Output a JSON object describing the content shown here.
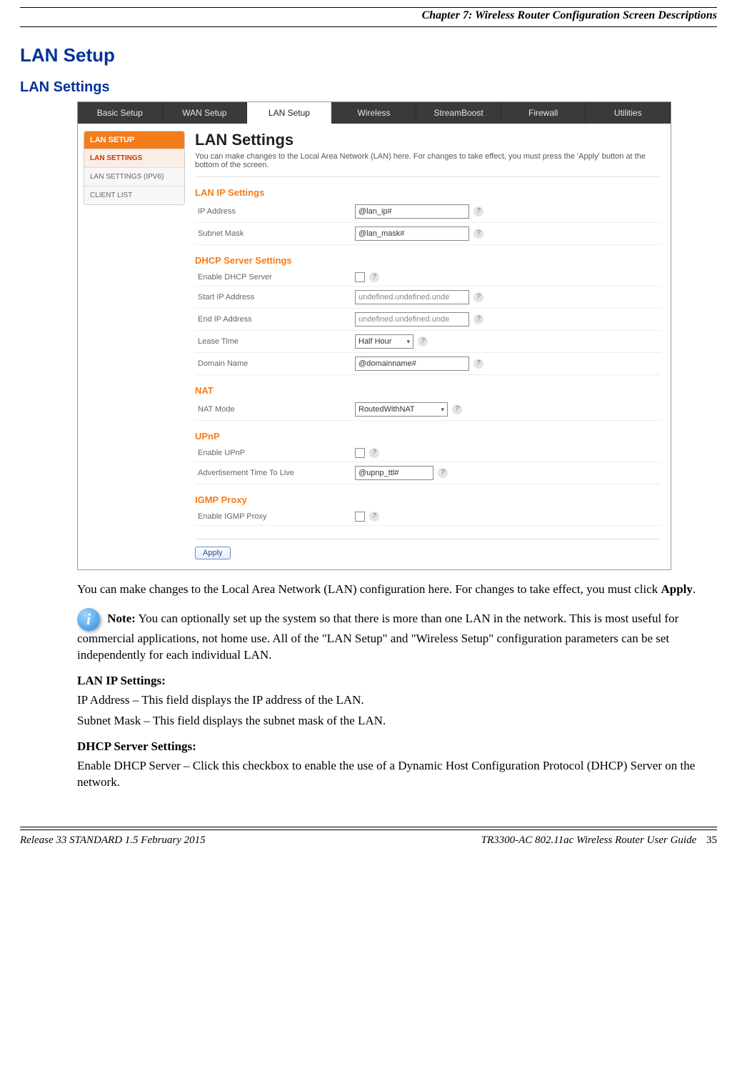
{
  "header": {
    "chapter": "Chapter 7: Wireless Router Configuration Screen Descriptions"
  },
  "headings": {
    "h1": "LAN Setup",
    "h2": "LAN Settings"
  },
  "screenshot": {
    "tabs": [
      "Basic Setup",
      "WAN Setup",
      "LAN Setup",
      "Wireless",
      "StreamBoost",
      "Firewall",
      "Utilities"
    ],
    "active_tab_index": 2,
    "sidebar": {
      "head": "LAN SETUP",
      "items": [
        "LAN SETTINGS",
        "LAN SETTINGS (IPV6)",
        "CLIENT LIST"
      ],
      "selected_index": 0
    },
    "title": "LAN Settings",
    "desc": "You can make changes to the Local Area Network (LAN) here. For changes to take effect, you must press the 'Apply' button at the bottom of the screen.",
    "sections": {
      "lanip": {
        "head": "LAN IP Settings",
        "ip_label": "IP Address",
        "ip_value": "@lan_ip#",
        "mask_label": "Subnet Mask",
        "mask_value": "@lan_mask#"
      },
      "dhcp": {
        "head": "DHCP Server Settings",
        "enable_label": "Enable DHCP Server",
        "start_label": "Start IP Address",
        "start_value": "undefined.undefined.unde",
        "end_label": "End IP Address",
        "end_value": "undefined.undefined.unde",
        "lease_label": "Lease Time",
        "lease_value": "Half Hour",
        "domain_label": "Domain Name",
        "domain_value": "@domainname#"
      },
      "nat": {
        "head": "NAT",
        "mode_label": "NAT Mode",
        "mode_value": "RoutedWithNAT"
      },
      "upnp": {
        "head": "UPnP",
        "enable_label": "Enable UPnP",
        "ttl_label": "Advertisement Time To Live",
        "ttl_value": "@upnp_ttl#"
      },
      "igmp": {
        "head": "IGMP Proxy",
        "enable_label": "Enable IGMP Proxy"
      }
    },
    "apply_label": "Apply"
  },
  "body": {
    "p1a": "You can make changes to the Local Area Network (LAN) configuration here. For changes to take effect, you must click ",
    "p1b": "Apply",
    "p1c": ".",
    "note_label": "Note:",
    "note_text": "  You can optionally set up the system so that there is more than one LAN in the network. This is most useful for commercial applications, not home use. All of the \"LAN Setup\" and \"Wireless Setup\" configuration parameters can be set independently for each individual LAN.",
    "lanip_head": "LAN IP Settings:",
    "ip_desc": "IP Address – This field displays the IP address of the LAN.",
    "mask_desc": "Subnet Mask – This field displays the subnet mask of the LAN.",
    "dhcp_head": "DHCP Server Settings:",
    "dhcp_enable_desc": "Enable DHCP Server – Click this checkbox to enable the use of a Dynamic Host Configuration Protocol (DHCP) Server on the network."
  },
  "footer": {
    "left": "Release 33 STANDARD 1.5    February 2015",
    "right_title": "TR3300-AC 802.11ac Wireless Router User Guide",
    "page": "35"
  }
}
